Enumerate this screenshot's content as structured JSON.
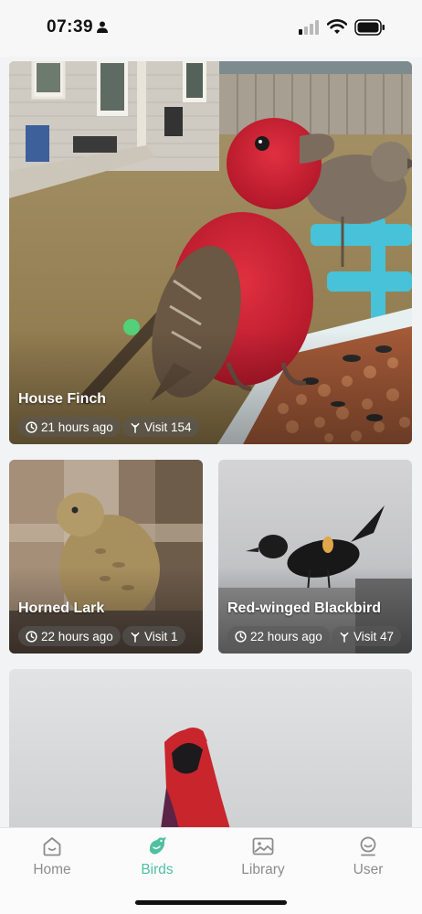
{
  "status_bar": {
    "time": "07:39"
  },
  "colors": {
    "accent": "#4fc0a1",
    "tab_inactive": "#8c8c8c",
    "chip_bg": "rgba(90,90,90,0.55)"
  },
  "cards": [
    {
      "name": "House Finch",
      "time_ago": "21 hours ago",
      "visit": "Visit 154"
    },
    {
      "name": "Horned Lark",
      "time_ago": "22 hours ago",
      "visit": "Visit 1"
    },
    {
      "name": "Red-winged Blackbird",
      "time_ago": "22 hours ago",
      "visit": "Visit 47"
    }
  ],
  "tabs": [
    {
      "label": "Home",
      "icon": "home-face-icon",
      "active": false
    },
    {
      "label": "Birds",
      "icon": "bird-icon",
      "active": true
    },
    {
      "label": "Library",
      "icon": "image-gallery-icon",
      "active": false
    },
    {
      "label": "User",
      "icon": "user-face-icon",
      "active": false
    }
  ]
}
